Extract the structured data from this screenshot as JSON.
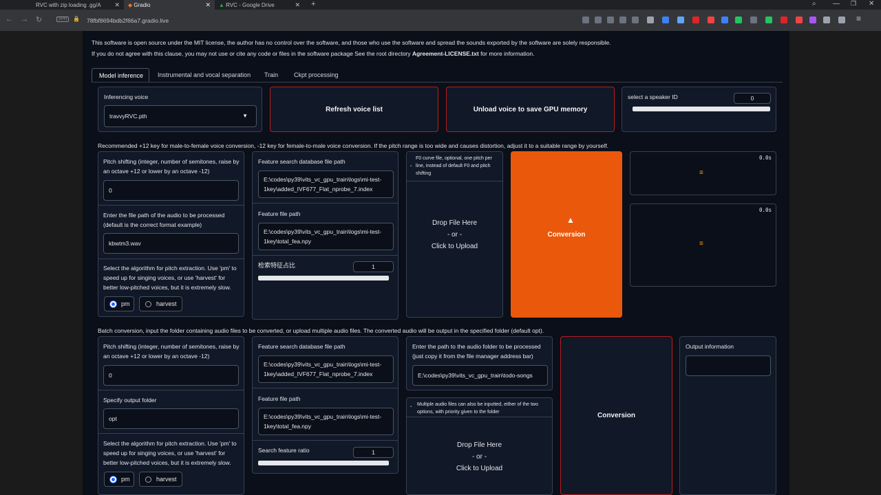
{
  "browser": {
    "tabs": [
      {
        "label": "RVC with zip loading .gg/A",
        "active": false
      },
      {
        "label": "Gradio",
        "active": true
      },
      {
        "label": "RVC - Google Drive",
        "active": false
      }
    ],
    "new_tab": "+",
    "url": "78fbf8694bdb2f66a7.gradio.live"
  },
  "notice": {
    "line1": "This software is open source under the MIT license, the author has no control over the software, and those who use the software and spread the sounds exported by the software are solely responsible.",
    "line2_prefix": "If you do not agree with this clause, you may not use or cite any code or files in the software package See the root directory ",
    "line2_bold": "Agreement-LICENSE.txt",
    "line2_suffix": " for more information."
  },
  "main_tabs": [
    "Model inference",
    "Instrumental and vocal separation",
    "Train",
    "Ckpt processing"
  ],
  "voice": {
    "label": "Inferencing voice",
    "value": "travvyRVC.pth",
    "refresh_button": "Refresh voice list",
    "unload_button": "Unload voice to save GPU memory",
    "speaker_label": "select a speaker ID",
    "speaker_value": "0"
  },
  "recommend_text": "Recommended +12 key for male-to-female voice conversion, -12 key for female-to-male voice conversion. If the pitch range is too wide and causes distortion, adjust it to a suitable range by yourself.",
  "single": {
    "pitch_label": "Pitch shifting (integer, number of semitones, raise by an octave +12 or lower by an octave -12)",
    "pitch_value": "0",
    "audio_path_label": "Enter the file path of the audio to be processed (default is the correct format example)",
    "audio_path_value": "kbwtm3.wav",
    "algo_label": "Select the algorithm for pitch extraction. Use 'pm' to speed up for singing voices, or use 'harvest' for better low-pitched voices, but it is extremely slow.",
    "algo_options": [
      "pm",
      "harvest"
    ],
    "algo_selected": "pm",
    "index_label": "Feature search database file path",
    "index_value": "E:\\codes\\py39\\vits_vc_gpu_train\\logs\\mi-test-1key\\added_IVF677_Flat_nprobe_7.index",
    "feature_label": "Feature file path",
    "feature_value": "E:\\codes\\py39\\vits_vc_gpu_train\\logs\\mi-test-1key\\total_fea.npy",
    "ratio_label": "检索特征占比",
    "ratio_value": "1",
    "f0_label": "F0 curve file, optional, one pitch per line, instead of default F0 and pitch shifting",
    "drop_line1": "Drop File Here",
    "drop_line2": "- or -",
    "drop_line3": "Click to Upload",
    "convert_button": "Conversion",
    "output1_time": "0.0s",
    "output2_time": "0.0s"
  },
  "batch_text": "Batch conversion, input the folder containing audio files to be converted, or upload multiple audio files. The converted audio will be output in the specified folder (default opt).",
  "batch": {
    "pitch_label": "Pitch shifting (integer, number of semitones, raise by an octave +12 or lower by an octave -12)",
    "pitch_value": "0",
    "out_folder_label": "Specify output folder",
    "out_folder_value": "opt",
    "algo_label": "Select the algorithm for pitch extraction. Use 'pm' to speed up for singing voices, or use 'harvest' for better low-pitched voices, but it is extremely slow.",
    "algo_options": [
      "pm",
      "harvest"
    ],
    "algo_selected": "pm",
    "index_label": "Feature search database file path",
    "index_value": "E:\\codes\\py39\\vits_vc_gpu_train\\logs\\mi-test-1key\\added_IVF677_Flat_nprobe_7.index",
    "feature_label": "Feature file path",
    "feature_value": "E:\\codes\\py39\\vits_vc_gpu_train\\logs\\mi-test-1key\\total_fea.npy",
    "ratio_label": "Search feature ratio",
    "ratio_value": "1",
    "folder_label": "Enter the path to the audio folder to be processed (just copy it from the file manager address bar)",
    "folder_value": "E:\\codes\\py39\\vits_vc_gpu_train\\todo-songs",
    "multi_label": "Multiple audio files can also be inputted, either of the two options, with priority given to the folder",
    "drop_line1": "Drop File Here",
    "drop_line2": "- or -",
    "drop_line3": "Click to Upload",
    "convert_button": "Conversion",
    "output_label": "Output information",
    "output_value": ""
  },
  "colors": {
    "accent": "#ea580c",
    "border_red": "#b91c1c",
    "bg": "#0b0f19",
    "panel": "#111827"
  }
}
